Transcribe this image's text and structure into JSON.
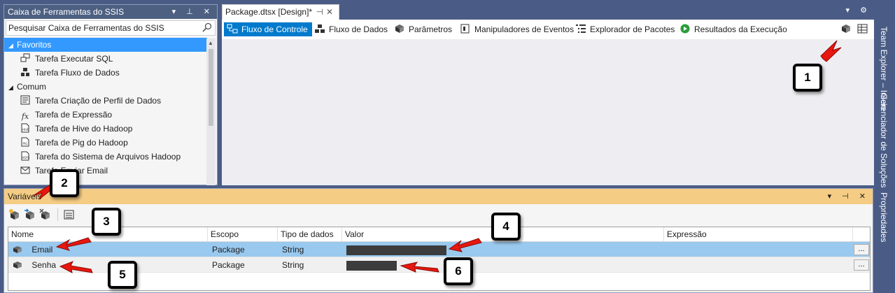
{
  "toolbox": {
    "title": "Caixa de Ferramentas do SSIS",
    "search_placeholder": "Pesquisar Caixa de Ferramentas do SSIS",
    "groups": [
      {
        "label": "Favoritos",
        "items": [
          "Tarefa Executar SQL",
          "Tarefa Fluxo de Dados"
        ]
      },
      {
        "label": "Comum",
        "items": [
          "Tarefa Criação de Perfil de Dados",
          "Tarefa de Expressão",
          "Tarefa de Hive do Hadoop",
          "Tarefa de Pig do Hadoop",
          "Tarefa do Sistema de Arquivos Hadoop",
          "Tarefa Enviar Email"
        ]
      }
    ]
  },
  "document": {
    "tab_title": "Package.dtsx [Design]*",
    "toolbar": {
      "control_flow": "Fluxo de Controle",
      "data_flow": "Fluxo de Dados",
      "parameters": "Parâmetros",
      "event_handlers": "Manipuladores de Eventos",
      "package_explorer": "Explorador de Pacotes",
      "execution_results": "Resultados da Execução"
    }
  },
  "side_tabs": [
    "Team Explorer – Início",
    "Gerenciador de Soluções",
    "Propriedades"
  ],
  "variables": {
    "title": "Variáveis",
    "columns": [
      "Nome",
      "Escopo",
      "Tipo de dados",
      "Valor",
      "Expressão"
    ],
    "rows": [
      {
        "name": "Email",
        "scope": "Package",
        "type": "String",
        "value": "████████████████",
        "expression": ""
      },
      {
        "name": "Senha",
        "scope": "Package",
        "type": "String",
        "value": "█████████",
        "expression": ""
      }
    ],
    "ellipsis": "..."
  },
  "annotations": [
    "1",
    "2",
    "3",
    "4",
    "5",
    "6"
  ],
  "colors": {
    "shell": "#4a5c86",
    "selection": "#3399ff",
    "accent_tab": "#007acc",
    "variables_header": "#f5cc84",
    "row_selected": "#99c9ef",
    "annotation_arrow": "#e8170f"
  }
}
